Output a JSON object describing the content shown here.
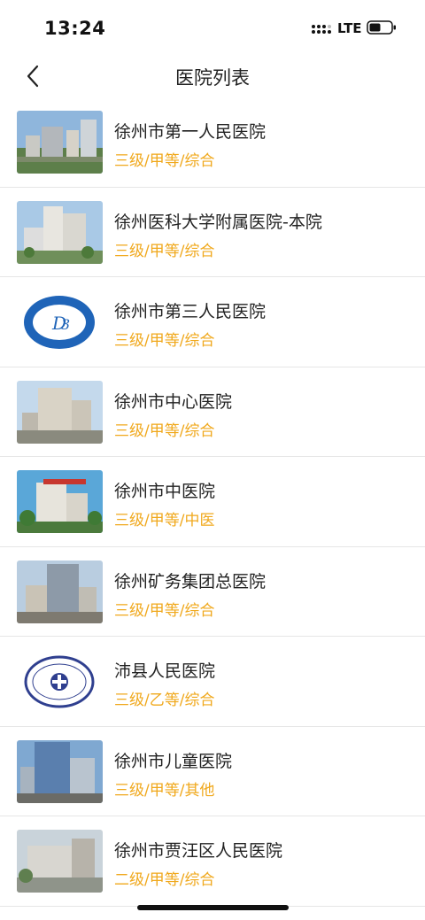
{
  "status_bar": {
    "time": "13:24",
    "network": "LTE",
    "signal_icon": "cellular-signal-icon",
    "battery_icon": "battery-icon"
  },
  "nav": {
    "back_icon": "chevron-left-icon",
    "title": "医院列表"
  },
  "hospitals": [
    {
      "name": "徐州市第一人民医院",
      "tags": "三级/甲等/综合",
      "thumb": "hospital-building-photo"
    },
    {
      "name": "徐州医科大学附属医院-本院",
      "tags": "三级/甲等/综合",
      "thumb": "hospital-building-photo"
    },
    {
      "name": "徐州市第三人民医院",
      "tags": "三级/甲等/综合",
      "thumb": "hospital-logo"
    },
    {
      "name": "徐州市中心医院",
      "tags": "三级/甲等/综合",
      "thumb": "hospital-building-photo"
    },
    {
      "name": "徐州市中医院",
      "tags": "三级/甲等/中医",
      "thumb": "hospital-building-photo"
    },
    {
      "name": "徐州矿务集团总医院",
      "tags": "三级/甲等/综合",
      "thumb": "hospital-building-photo"
    },
    {
      "name": "沛县人民医院",
      "tags": "三级/乙等/综合",
      "thumb": "hospital-logo"
    },
    {
      "name": "徐州市儿童医院",
      "tags": "三级/甲等/其他",
      "thumb": "hospital-building-photo"
    },
    {
      "name": "徐州市贾汪区人民医院",
      "tags": "二级/甲等/综合",
      "thumb": "hospital-building-photo"
    }
  ],
  "colors": {
    "tag_color": "#f0a81c",
    "divider": "#e6e6e6"
  }
}
